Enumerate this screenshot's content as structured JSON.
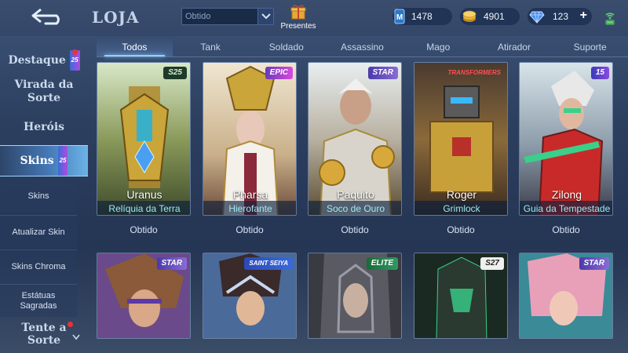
{
  "header": {
    "title": "LOJA",
    "filter": {
      "value": "Obtido"
    },
    "gifts_label": "Presentes",
    "currencies": [
      {
        "name": "ticket",
        "value": "1478",
        "icon": "ticket-icon",
        "color": "#2f8fe0"
      },
      {
        "name": "gold",
        "value": "4901",
        "icon": "gold-coin-icon",
        "color": "#e8b53a"
      },
      {
        "name": "diamond",
        "value": "123",
        "icon": "diamond-icon",
        "color": "#5fa8ff"
      }
    ],
    "add_label": "+"
  },
  "tabs": [
    "Todos",
    "Tank",
    "Soldado",
    "Assassino",
    "Mago",
    "Atirador",
    "Suporte"
  ],
  "sidebar": {
    "featured": "Destaque",
    "fortune": "Virada da Sorte",
    "heroes": "Heróis",
    "skins": "Skins",
    "skins_sub": "Skins",
    "upgrade": "Atualizar Skin",
    "chroma": "Skins Chroma",
    "statues": "Estátuas Sagradas",
    "luck": "Tente a Sorte",
    "badge": "25"
  },
  "cards_row1": [
    {
      "hero": "Uranus",
      "skin": "Relíquia da Terra",
      "series": "S25",
      "status": "Obtido",
      "accent": "#c9a53a"
    },
    {
      "hero": "Pharsa",
      "skin": "Hierofante",
      "series": "EPIC",
      "status": "Obtido",
      "accent": "#b46cd8"
    },
    {
      "hero": "Paquito",
      "skin": "Soco de Ouro",
      "series": "STAR",
      "status": "Obtido",
      "accent": "#8a6bd6"
    },
    {
      "hero": "Roger",
      "skin": "Grimlock",
      "series": "TRANSFORMERS",
      "status": "Obtido",
      "accent": "#d83a3a"
    },
    {
      "hero": "Zilong",
      "skin": "Guia da Tempestade",
      "series": "15",
      "status": "Obtido",
      "accent": "#6b7cf0"
    }
  ],
  "cards_row2": [
    {
      "series": "STAR",
      "accent": "#8a6bd6"
    },
    {
      "series": "SAINT SEIYA",
      "accent": "#3a6ad8"
    },
    {
      "series": "ELITE",
      "accent": "#2f9a62"
    },
    {
      "series": "S27",
      "accent": "#333333"
    },
    {
      "series": "STAR",
      "accent": "#8a6bd6"
    }
  ]
}
